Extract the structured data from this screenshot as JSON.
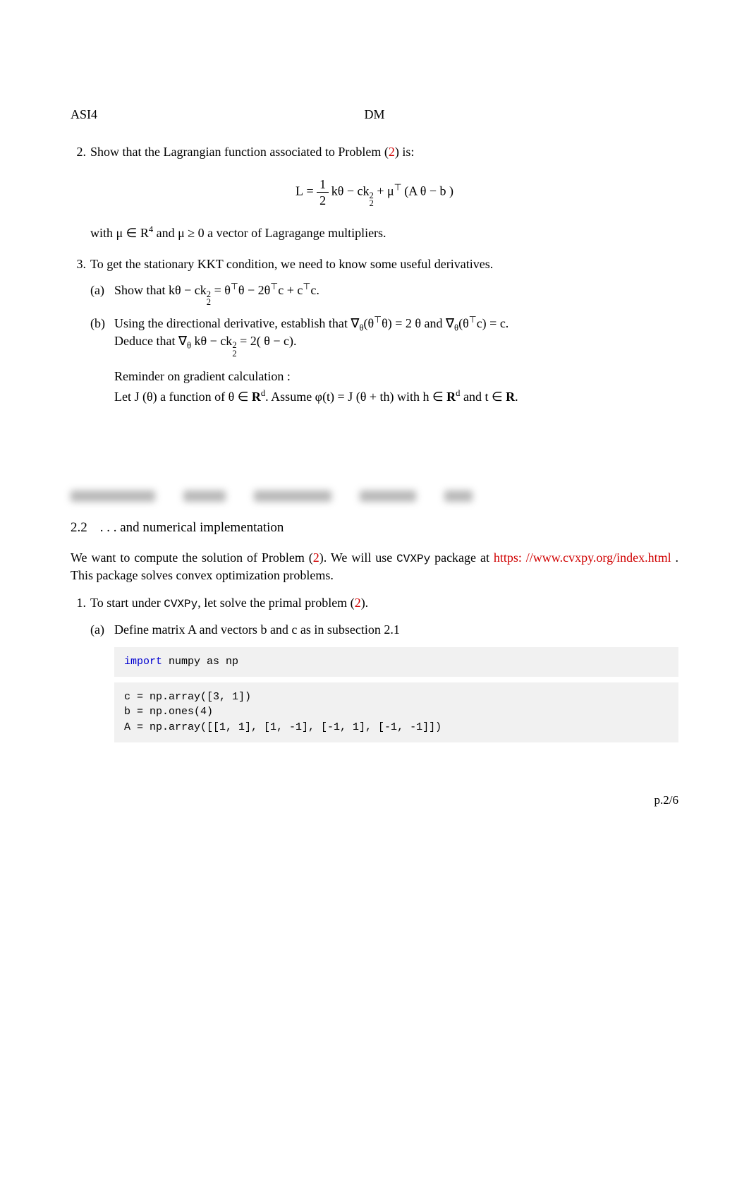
{
  "header": {
    "left": "ASI4",
    "center": "DM"
  },
  "items": {
    "q2": {
      "num": "2.",
      "text_a": "Show that the Lagrangian function associated to Problem (",
      "ref": "2",
      "text_b": ") is:"
    },
    "q2_with": {
      "a": "with μ ∈ R",
      "exp": "4",
      "b": " and μ ≥ 0 a vector of Lagragange multipliers."
    },
    "q3": {
      "num": "3.",
      "text": "To get the stationary KKT condition, we need to know some useful derivatives."
    },
    "q3a": {
      "label": "(a)",
      "t1": "Show that kθ − ck",
      "t2": " = θ",
      "t3": "θ − 2θ",
      "t4": "c + c",
      "t5": "c."
    },
    "q3b": {
      "label": "(b)",
      "line1_a": "Using the directional derivative, establish that ∇",
      "line1_b": "(θ",
      "line1_c": "θ) = 2 θ and ∇",
      "line1_d": "(θ",
      "line1_e": "c) =  c.",
      "line2_a": "Deduce that ∇",
      "line2_b": " kθ −  ck",
      "line2_c": " = 2( θ −  c)."
    },
    "reminder": {
      "title": "Reminder on gradient calculation :",
      "a": "Let J (θ) a function of θ ∈ ",
      "b": ". Assume φ(t) =  J (θ + th) with h ∈ ",
      "c": " and t ∈ ",
      "d": "."
    }
  },
  "section": {
    "num": "2.2",
    "title": ". . . and numerical implementation"
  },
  "intro": {
    "a": "We want to compute the solution of Problem (",
    "ref": "2",
    "b": "). We will use ",
    "pkg": "CVXPy",
    "c": " package at ",
    "url": "https: //www.cvxpy.org/index.html",
    "d": " . This package solves convex optimization problems."
  },
  "prob1": {
    "num": "1.",
    "a": "To start under ",
    "pkg": "CVXPy",
    "b": ", let solve the primal problem (",
    "ref": "2",
    "c": ")."
  },
  "prob1a": {
    "label": "(a)",
    "a": "Define matrix A and vectors b and c as in subsection 2.1"
  },
  "code1": {
    "l1a": "import   ",
    "l1b": "numpy as np"
  },
  "code2": {
    "l1": "c = np.array([3, 1])",
    "l2": "b = np.ones(4)",
    "l3": "A = np.array([[1, 1], [1, -1], [-1, 1], [-1, -1]])"
  },
  "page": "p.2/6"
}
